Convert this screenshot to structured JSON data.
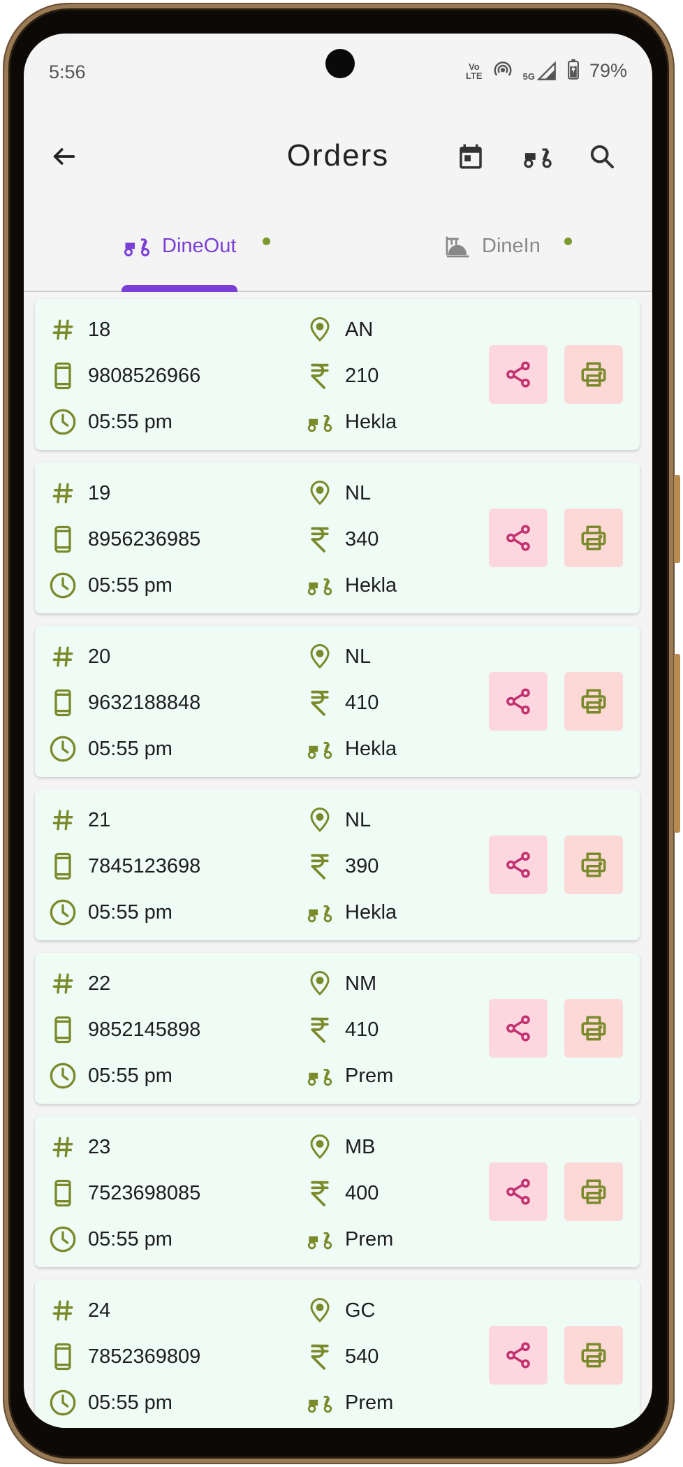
{
  "status_bar": {
    "time": "5:56",
    "network_lte_top": "Vo",
    "network_lte_bottom": "LTE",
    "network_5g": "5G",
    "battery_percent": "79%"
  },
  "app_bar": {
    "title": "Orders",
    "icons": [
      "back-arrow-icon",
      "calendar-icon",
      "scooter-icon",
      "search-icon"
    ]
  },
  "tabs": [
    {
      "label": "DineOut",
      "selected": true,
      "icon": "scooter-icon",
      "has_dot": true
    },
    {
      "label": "DineIn",
      "selected": false,
      "icon": "dine-in-icon",
      "has_dot": true
    }
  ],
  "orders": [
    {
      "order_no": "18",
      "phone": "9808526966",
      "time": "05:55 pm",
      "location": "AN",
      "amount": "210",
      "rider": "Hekla"
    },
    {
      "order_no": "19",
      "phone": "8956236985",
      "time": "05:55 pm",
      "location": "NL",
      "amount": "340",
      "rider": "Hekla"
    },
    {
      "order_no": "20",
      "phone": "9632188848",
      "time": "05:55 pm",
      "location": "NL",
      "amount": "410",
      "rider": "Hekla"
    },
    {
      "order_no": "21",
      "phone": "7845123698",
      "time": "05:55 pm",
      "location": "NL",
      "amount": "390",
      "rider": "Hekla"
    },
    {
      "order_no": "22",
      "phone": "9852145898",
      "time": "05:55 pm",
      "location": "NM",
      "amount": "410",
      "rider": "Prem"
    },
    {
      "order_no": "23",
      "phone": "7523698085",
      "time": "05:55 pm",
      "location": "MB",
      "amount": "400",
      "rider": "Prem"
    },
    {
      "order_no": "24",
      "phone": "7852369809",
      "time": "05:55 pm",
      "location": "GC",
      "amount": "540",
      "rider": "Prem"
    }
  ],
  "colors": {
    "accent_purple": "#7b3fd6",
    "icon_olive": "#7a8a2a",
    "share_pink": "#c2306f",
    "card_bg": "#effcf6"
  }
}
